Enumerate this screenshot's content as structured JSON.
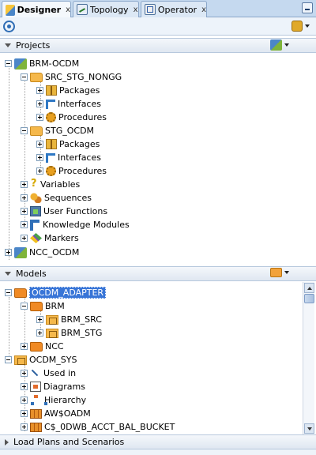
{
  "tabs": [
    {
      "label": "Designer",
      "close": "x"
    },
    {
      "label": "Topology",
      "close": "x"
    },
    {
      "label": "Operator",
      "close": "x"
    }
  ],
  "sections": {
    "projects": "Projects",
    "models": "Models",
    "loadplans": "Load Plans and Scenarios"
  },
  "projects_tree": {
    "brm": "BRM-OCDM",
    "src_folder": "SRC_STG_NONGG",
    "src_packages": "Packages",
    "src_interfaces": "Interfaces",
    "src_procedures": "Procedures",
    "stg_folder": "STG_OCDM",
    "stg_packages": "Packages",
    "stg_interfaces": "Interfaces",
    "stg_procedures": "Procedures",
    "variables": "Variables",
    "sequences": "Sequences",
    "user_functions": "User Functions",
    "knowledge_modules": "Knowledge Modules",
    "markers": "Markers",
    "ncc": "NCC_OCDM"
  },
  "models_tree": {
    "ocdm_adapter": "OCDM_ADAPTER",
    "brm": "BRM",
    "brm_src": "BRM_SRC",
    "brm_stg": "BRM_STG",
    "ncc": "NCC",
    "ocdm_sys": "OCDM_SYS",
    "used_in": "Used in",
    "diagrams": "Diagrams",
    "hierarchy": "Hierarchy",
    "aw": "AW$OADM",
    "cdwb": "C$_0DWB_ACCT_BAL_BUCKET"
  }
}
